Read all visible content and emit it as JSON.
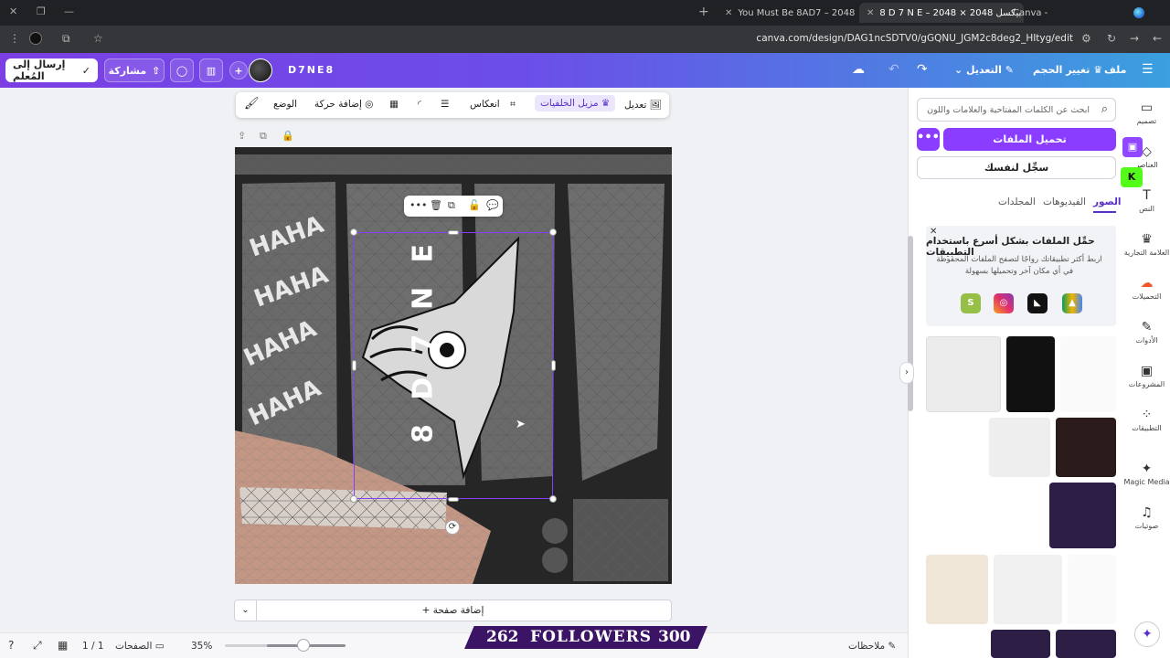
{
  "browser": {
    "tabs": [
      {
        "title": "Canva -"
      },
      {
        "title": "8 D 7 N E – 2048 × 2048 بيكسل",
        "active": true
      },
      {
        "title": "You Must Be 8AD7 – 2048 × 2048"
      }
    ],
    "url": "canva.com/design/DAG1ncSDTV0/gGQNU_JGM2c8deg2_HItyg/edit"
  },
  "header": {
    "menu_file": "ملف",
    "menu_resize": "تغيير الحجم",
    "menu_edit": "التعديل",
    "design_name": "D7NE8",
    "share_label": "مشاركة",
    "send_teacher_label": "إرسال إلى المُعلم"
  },
  "context_toolbar": {
    "edit": "تعديل",
    "bg_remover": "مزيل الخلفيات",
    "flip": "انعكاس",
    "animate": "إضافة حركة",
    "position": "الوضع"
  },
  "canvas": {
    "vertical_text": "8 D 7 N E",
    "add_page": "+ إضافة صفحة"
  },
  "bottom_bar": {
    "notes": "ملاحظات",
    "zoom": "35%",
    "zoom_level": 0.35,
    "pages": "الصفحات",
    "page_count": "1 / 1"
  },
  "overlay": {
    "followers_left": "262",
    "followers_label": "FOLLOWERS",
    "followers_right": "300"
  },
  "panel": {
    "search_placeholder": "ابحث عن الكلمات المفتاحية والعلامات واللون",
    "upload_label": "تحميل الملفات",
    "record_label": "سجِّل لنفسك",
    "tabs": {
      "images": "الصور",
      "videos": "الفيديوهات",
      "folders": "المجلدات"
    },
    "promo_title": "حمِّل الملفات بشكل أسرع باستخدام التطبيقات",
    "promo_text": "اربط أكثر تطبيقاتك رواجًا لتصفح الملفات المحفوظة في أي مكان آخر وتحميلها بسهولة"
  },
  "rail": {
    "design": "تصميم",
    "elements": "العناصر",
    "text": "النص",
    "brand": "العلامة التجارية",
    "uploads": "التحميلات",
    "tools": "الأدوات",
    "projects": "المشروعات",
    "apps": "التطبيقات",
    "magic_media": "Magic Media",
    "audio": "صوتيات"
  },
  "colors": {
    "accent": "#8b3dff",
    "header_start": "#7b3fe4",
    "header_end": "#3aa0de"
  }
}
